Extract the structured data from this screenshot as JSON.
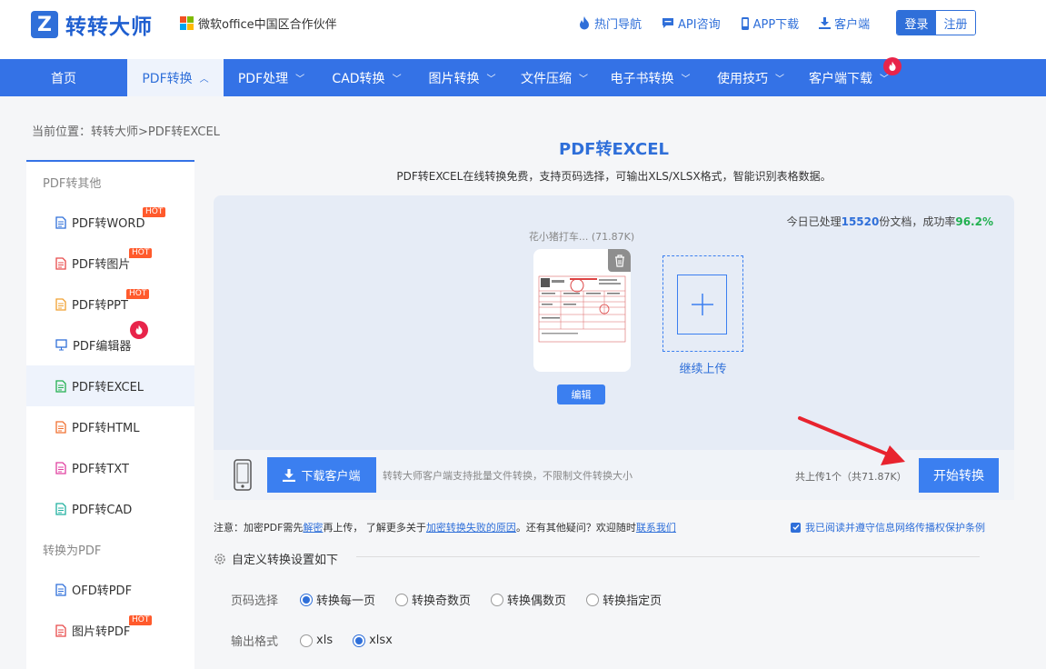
{
  "logo": {
    "mark": "Z",
    "text": "转转大师"
  },
  "partner": {
    "text": "微软office中国区合作伙伴",
    "colors": [
      "#f25022",
      "#7fba00",
      "#00a4ef",
      "#ffb900"
    ]
  },
  "top_links": [
    {
      "label": "热门导航",
      "icon": "fire-icon"
    },
    {
      "label": "API咨询",
      "icon": "chat-icon"
    },
    {
      "label": "APP下载",
      "icon": "phone-icon"
    },
    {
      "label": "客户端",
      "icon": "download-icon"
    }
  ],
  "auth": {
    "login": "登录",
    "register": "注册"
  },
  "nav": {
    "items": [
      {
        "label": "首页",
        "chevron": ""
      },
      {
        "label": "PDF转换",
        "chevron": "︿"
      },
      {
        "label": "PDF处理",
        "chevron": "﹀"
      },
      {
        "label": "CAD转换",
        "chevron": "﹀"
      },
      {
        "label": "图片转换",
        "chevron": "﹀"
      },
      {
        "label": "文件压缩",
        "chevron": "﹀"
      },
      {
        "label": "电子书转换",
        "chevron": "﹀"
      },
      {
        "label": "使用技巧",
        "chevron": "﹀"
      },
      {
        "label": "客户端下载",
        "chevron": "﹀"
      }
    ]
  },
  "breadcrumb": "当前位置：转转大师>PDF转EXCEL",
  "sidebar": {
    "cat1": "PDF转其他",
    "items1": [
      {
        "label": "PDF转WORD",
        "badge": "HOT",
        "color": "#2f6fd9"
      },
      {
        "label": "PDF转图片",
        "badge": "HOT",
        "color": "#e84a4a"
      },
      {
        "label": "PDF转PPT",
        "badge": "HOT",
        "color": "#f0a030"
      },
      {
        "label": "PDF编辑器",
        "badge": "",
        "color": "#2f6fd9"
      },
      {
        "label": "PDF转EXCEL",
        "badge": "",
        "color": "#22b050"
      },
      {
        "label": "PDF转HTML",
        "badge": "",
        "color": "#f07030"
      },
      {
        "label": "PDF转TXT",
        "badge": "",
        "color": "#e040a0"
      },
      {
        "label": "PDF转CAD",
        "badge": "",
        "color": "#20b0a0"
      }
    ],
    "cat2": "转换为PDF",
    "items2": [
      {
        "label": "OFD转PDF",
        "badge": "",
        "color": "#2f6fd9"
      },
      {
        "label": "图片转PDF",
        "badge": "HOT",
        "color": "#e84a4a"
      }
    ]
  },
  "main": {
    "title": "PDF转EXCEL",
    "desc": "PDF转EXCEL在线转换免费，支持页码选择，可输出XLS/XLSX格式，智能识别表格数据。"
  },
  "stats": {
    "prefix": "今日已处理",
    "count": "15520",
    "mid": "份文档，成功率",
    "rate": "96.2%"
  },
  "file": {
    "name": "花小猪打车... (71.87K)",
    "edit": "编辑"
  },
  "upload": {
    "label": "继续上传"
  },
  "action": {
    "download_btn": "下载客户端",
    "download_note": "转转大师客户端支持批量文件转换，不限制文件转换大小",
    "count": "共上传1个（共71.87K）",
    "start": "开始转换"
  },
  "note": {
    "p1": "注意：加密PDF需先",
    "l1": "解密",
    "p2": "再上传， 了解更多关于",
    "l2": "加密转换失败的原因",
    "p3": "。还有其他疑问？欢迎随时",
    "l3": "联系我们"
  },
  "agree": "我已阅读并遵守信息网络传播权保护条例",
  "settings": {
    "title": "自定义转换设置如下",
    "page_label": "页码选择",
    "page_options": [
      "转换每一页",
      "转换奇数页",
      "转换偶数页",
      "转换指定页"
    ],
    "page_selected": 0,
    "format_label": "输出格式",
    "format_options": [
      "xls",
      "xlsx"
    ],
    "format_selected": 1
  }
}
